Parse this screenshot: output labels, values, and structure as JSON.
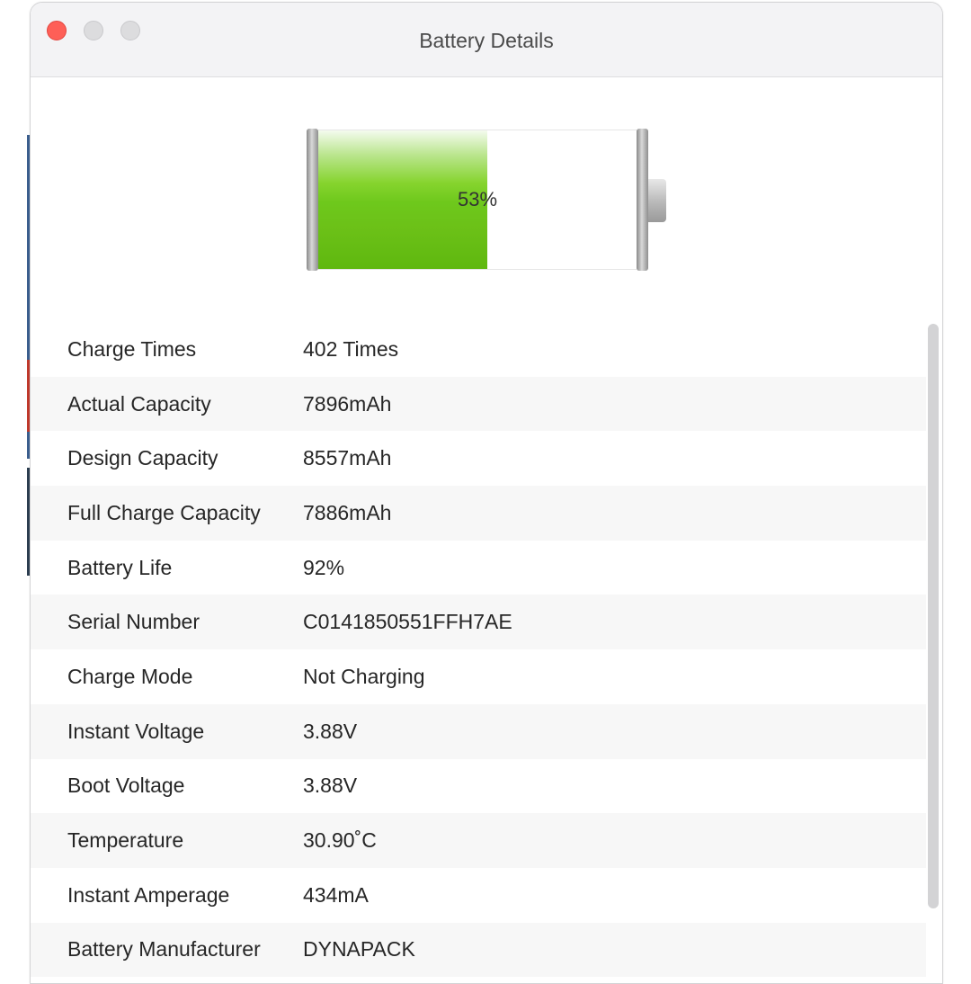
{
  "window": {
    "title": "Battery Details"
  },
  "battery": {
    "level_percent": 53,
    "label": "53%",
    "fill_color": "#6ec81c"
  },
  "details": [
    {
      "label": "Charge Times",
      "value": "402 Times"
    },
    {
      "label": "Actual Capacity",
      "value": "7896mAh"
    },
    {
      "label": "Design Capacity",
      "value": "8557mAh"
    },
    {
      "label": "Full Charge Capacity",
      "value": "7886mAh"
    },
    {
      "label": "Battery Life",
      "value": "92%"
    },
    {
      "label": "Serial Number",
      "value": "C0141850551FFH7AE"
    },
    {
      "label": "Charge Mode",
      "value": "Not Charging"
    },
    {
      "label": "Instant Voltage",
      "value": "3.88V"
    },
    {
      "label": "Boot Voltage",
      "value": "3.88V"
    },
    {
      "label": "Temperature",
      "value": "30.90˚C"
    },
    {
      "label": "Instant Amperage",
      "value": "434mA"
    },
    {
      "label": "Battery Manufacturer",
      "value": "DYNAPACK"
    }
  ],
  "colors": {
    "close": "#fe5f57",
    "inactive_button": "#dcdcde",
    "row_stripe": "#f7f7f7"
  }
}
